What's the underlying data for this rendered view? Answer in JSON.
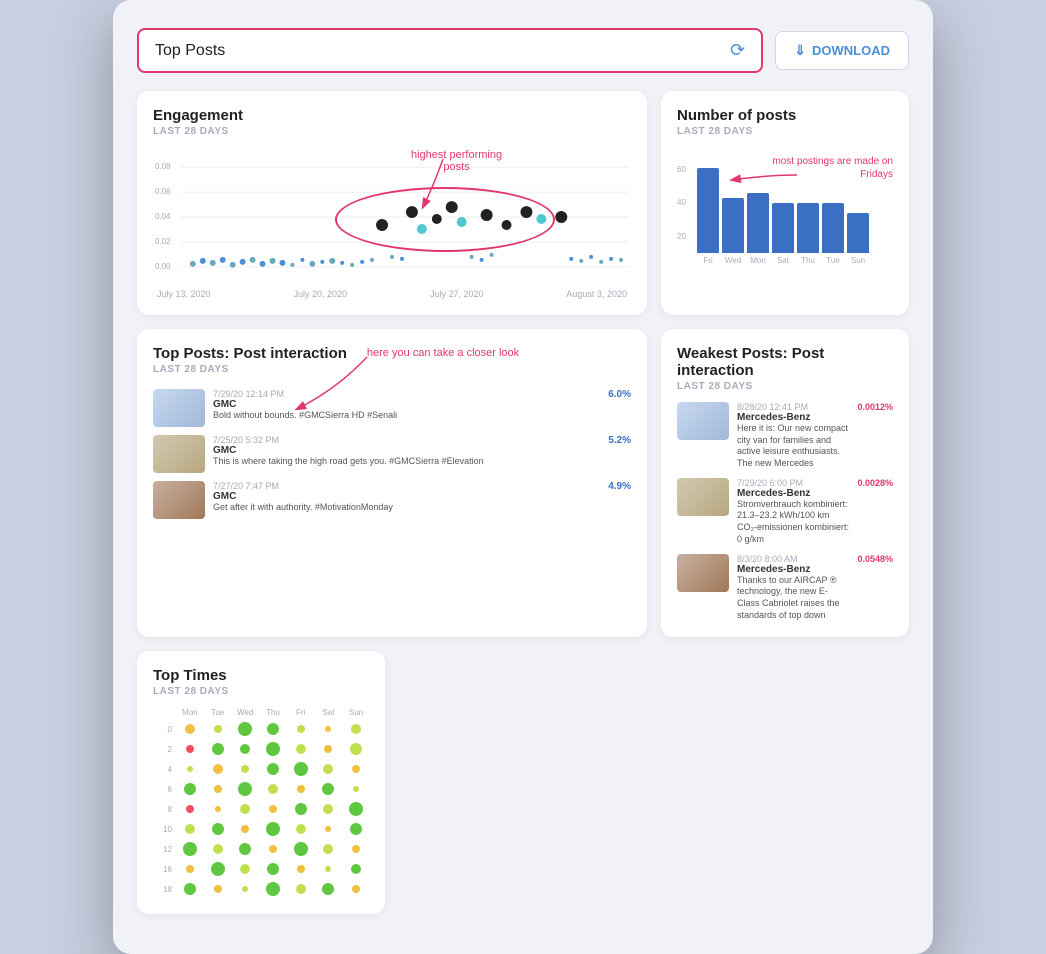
{
  "topbar": {
    "selector_label": "Top Posts",
    "download_label": "DOWNLOAD"
  },
  "engagement_card": {
    "title": "Engagement",
    "subtitle": "LAST 28 DAYS",
    "annotation_highest": "highest performing posts",
    "x_labels": [
      "July 13, 2020",
      "July 20, 2020",
      "July 27, 2020",
      "August 3, 2020"
    ],
    "y_labels": [
      "0.08",
      "0.06",
      "0.04",
      "0.02",
      "0.00"
    ]
  },
  "posts_card": {
    "title": "Number of posts",
    "subtitle": "LAST 28 DAYS",
    "annotation_postings": "most postings are made on Fridays",
    "bars": [
      {
        "day": "Fri",
        "height": 85
      },
      {
        "day": "Wed",
        "height": 55
      },
      {
        "day": "Mon",
        "height": 60
      },
      {
        "day": "Sat",
        "height": 50
      },
      {
        "day": "Thu",
        "height": 50
      },
      {
        "day": "Tue",
        "height": 50
      },
      {
        "day": "Sun",
        "height": 40
      }
    ],
    "y_labels": [
      "60",
      "40",
      "20"
    ]
  },
  "top_posts_card": {
    "title": "Top Posts: Post interaction",
    "subtitle": "LAST 28 DAYS",
    "annotation": "here you can take a closer look",
    "posts": [
      {
        "date": "7/29/20 12:14 PM",
        "brand": "GMC",
        "text": "Bold without bounds. #GMCSierra HD #Senali",
        "stat": "6.0%",
        "thumb_class": "post-thumb-engagement"
      },
      {
        "date": "7/25/20 5:32 PM",
        "brand": "GMC",
        "text": "This is where taking the high road gets you. #GMCSierra #Elevation",
        "stat": "5.2%",
        "thumb_class": "post-thumb-road"
      },
      {
        "date": "7/27/20 7:47 PM",
        "brand": "GMC",
        "text": "Get after it with authority. #MotivationMonday",
        "stat": "4.9%",
        "thumb_class": "post-thumb-truck"
      }
    ]
  },
  "weakest_posts_card": {
    "title": "Weakest Posts: Post interaction",
    "subtitle": "LAST 28 DAYS",
    "posts": [
      {
        "date": "8/28/20 12:41 PM",
        "brand": "Mercedes-Benz",
        "text": "Here it is: Our new compact city van for families and active leisure enthusiasts. The new Mercedes",
        "stat": "0.0012%",
        "thumb_class": "post-thumb-engagement"
      },
      {
        "date": "7/29/20 6:00 PM",
        "brand": "Mercedes-Benz",
        "text": "Stromverbrauch kombiniert: 21.3–23.2 kWh/100 km CO₂-emissionen kombiniert: 0 g/km",
        "stat": "0.0028%",
        "thumb_class": "post-thumb-road"
      },
      {
        "date": "8/3/20 8:00 AM",
        "brand": "Mercedes-Benz",
        "text": "Thanks to our AIRCAP ® technology, the new E-Class Cabriolet raises the standards of top down",
        "stat": "0.0548%",
        "thumb_class": "post-thumb-truck"
      }
    ]
  },
  "top_times_card": {
    "title": "Top Times",
    "subtitle": "LAST 28 DAYS",
    "day_labels": [
      "Mon",
      "Tue",
      "Wed",
      "Thu",
      "Fri",
      "Sat",
      "Sun"
    ],
    "hour_labels": [
      "0",
      "2",
      "4",
      "6",
      "8",
      "10",
      "12",
      "16",
      "18"
    ],
    "dots": [
      {
        "row": 1,
        "col": 1,
        "size": 10,
        "color": "#f0c040"
      },
      {
        "row": 1,
        "col": 2,
        "size": 8,
        "color": "#c0e050"
      },
      {
        "row": 1,
        "col": 3,
        "size": 14,
        "color": "#60c840"
      },
      {
        "row": 1,
        "col": 4,
        "size": 12,
        "color": "#60c840"
      },
      {
        "row": 1,
        "col": 5,
        "size": 8,
        "color": "#c0e050"
      },
      {
        "row": 1,
        "col": 6,
        "size": 6,
        "color": "#f0c040"
      },
      {
        "row": 1,
        "col": 7,
        "size": 10,
        "color": "#c0e050"
      },
      {
        "row": 2,
        "col": 1,
        "size": 8,
        "color": "#f05060"
      },
      {
        "row": 2,
        "col": 2,
        "size": 12,
        "color": "#60c840"
      },
      {
        "row": 2,
        "col": 3,
        "size": 10,
        "color": "#60c840"
      },
      {
        "row": 2,
        "col": 4,
        "size": 14,
        "color": "#60c840"
      },
      {
        "row": 2,
        "col": 5,
        "size": 10,
        "color": "#c0e050"
      },
      {
        "row": 2,
        "col": 6,
        "size": 8,
        "color": "#f0c040"
      },
      {
        "row": 2,
        "col": 7,
        "size": 12,
        "color": "#c0e050"
      },
      {
        "row": 3,
        "col": 1,
        "size": 6,
        "color": "#c0e050"
      },
      {
        "row": 3,
        "col": 2,
        "size": 10,
        "color": "#f0c040"
      },
      {
        "row": 3,
        "col": 3,
        "size": 8,
        "color": "#c0e050"
      },
      {
        "row": 3,
        "col": 4,
        "size": 12,
        "color": "#60c840"
      },
      {
        "row": 3,
        "col": 5,
        "size": 14,
        "color": "#60c840"
      },
      {
        "row": 3,
        "col": 6,
        "size": 10,
        "color": "#c0e050"
      },
      {
        "row": 3,
        "col": 7,
        "size": 8,
        "color": "#f0c040"
      },
      {
        "row": 4,
        "col": 1,
        "size": 12,
        "color": "#60c840"
      },
      {
        "row": 4,
        "col": 2,
        "size": 8,
        "color": "#f0c040"
      },
      {
        "row": 4,
        "col": 3,
        "size": 14,
        "color": "#60c840"
      },
      {
        "row": 4,
        "col": 4,
        "size": 10,
        "color": "#c0e050"
      },
      {
        "row": 4,
        "col": 5,
        "size": 8,
        "color": "#f0c040"
      },
      {
        "row": 4,
        "col": 6,
        "size": 12,
        "color": "#60c840"
      },
      {
        "row": 4,
        "col": 7,
        "size": 6,
        "color": "#c0e050"
      },
      {
        "row": 5,
        "col": 1,
        "size": 8,
        "color": "#f05060"
      },
      {
        "row": 5,
        "col": 2,
        "size": 6,
        "color": "#f0c040"
      },
      {
        "row": 5,
        "col": 3,
        "size": 10,
        "color": "#c0e050"
      },
      {
        "row": 5,
        "col": 4,
        "size": 8,
        "color": "#f0c040"
      },
      {
        "row": 5,
        "col": 5,
        "size": 12,
        "color": "#60c840"
      },
      {
        "row": 5,
        "col": 6,
        "size": 10,
        "color": "#c0e050"
      },
      {
        "row": 5,
        "col": 7,
        "size": 14,
        "color": "#60c840"
      },
      {
        "row": 6,
        "col": 1,
        "size": 10,
        "color": "#c0e050"
      },
      {
        "row": 6,
        "col": 2,
        "size": 12,
        "color": "#60c840"
      },
      {
        "row": 6,
        "col": 3,
        "size": 8,
        "color": "#f0c040"
      },
      {
        "row": 6,
        "col": 4,
        "size": 14,
        "color": "#60c840"
      },
      {
        "row": 6,
        "col": 5,
        "size": 10,
        "color": "#c0e050"
      },
      {
        "row": 6,
        "col": 6,
        "size": 6,
        "color": "#f0c040"
      },
      {
        "row": 6,
        "col": 7,
        "size": 12,
        "color": "#60c840"
      },
      {
        "row": 7,
        "col": 1,
        "size": 14,
        "color": "#60c840"
      },
      {
        "row": 7,
        "col": 2,
        "size": 10,
        "color": "#c0e050"
      },
      {
        "row": 7,
        "col": 3,
        "size": 12,
        "color": "#60c840"
      },
      {
        "row": 7,
        "col": 4,
        "size": 8,
        "color": "#f0c040"
      },
      {
        "row": 7,
        "col": 5,
        "size": 14,
        "color": "#60c840"
      },
      {
        "row": 7,
        "col": 6,
        "size": 10,
        "color": "#c0e050"
      },
      {
        "row": 7,
        "col": 7,
        "size": 8,
        "color": "#f0c040"
      },
      {
        "row": 8,
        "col": 1,
        "size": 8,
        "color": "#f0c040"
      },
      {
        "row": 8,
        "col": 2,
        "size": 14,
        "color": "#60c840"
      },
      {
        "row": 8,
        "col": 3,
        "size": 10,
        "color": "#c0e050"
      },
      {
        "row": 8,
        "col": 4,
        "size": 12,
        "color": "#60c840"
      },
      {
        "row": 8,
        "col": 5,
        "size": 8,
        "color": "#f0c040"
      },
      {
        "row": 8,
        "col": 6,
        "size": 6,
        "color": "#c0e050"
      },
      {
        "row": 8,
        "col": 7,
        "size": 10,
        "color": "#60c840"
      },
      {
        "row": 9,
        "col": 1,
        "size": 12,
        "color": "#60c840"
      },
      {
        "row": 9,
        "col": 2,
        "size": 8,
        "color": "#f0c040"
      },
      {
        "row": 9,
        "col": 3,
        "size": 6,
        "color": "#c0e050"
      },
      {
        "row": 9,
        "col": 4,
        "size": 14,
        "color": "#60c840"
      },
      {
        "row": 9,
        "col": 5,
        "size": 10,
        "color": "#c0e050"
      },
      {
        "row": 9,
        "col": 6,
        "size": 12,
        "color": "#60c840"
      },
      {
        "row": 9,
        "col": 7,
        "size": 8,
        "color": "#f0c040"
      }
    ]
  }
}
